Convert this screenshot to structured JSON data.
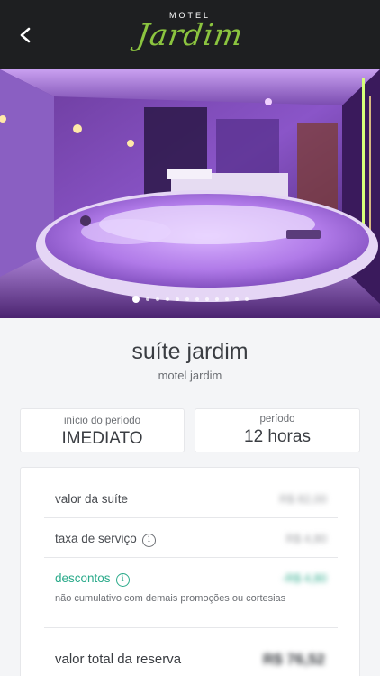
{
  "header": {
    "logo_top": "MOTEL",
    "logo_main": "Jardim"
  },
  "hero": {
    "photo_count": 12,
    "active_photo": 1
  },
  "suite": {
    "name": "suíte jardim",
    "motel": "motel jardim"
  },
  "period_start": {
    "label": "início do período",
    "value": "IMEDIATO"
  },
  "period": {
    "label": "período",
    "value": "12 horas"
  },
  "pricing": {
    "suite_label": "valor da suíte",
    "suite_value": "R$ 82,00",
    "service_label": "taxa de serviço",
    "service_value": "R$ 4,80",
    "discount_label": "descontos",
    "discount_value": "-R$ 4,80",
    "discount_note": "não cumulativo com demais promoções ou cortesias",
    "total_label": "valor total da reserva",
    "total_value": "R$ 76,52"
  },
  "colors": {
    "accent_green": "#8bc43f",
    "discount_teal": "#2aaa8a",
    "header_bg": "#1e1f21"
  }
}
